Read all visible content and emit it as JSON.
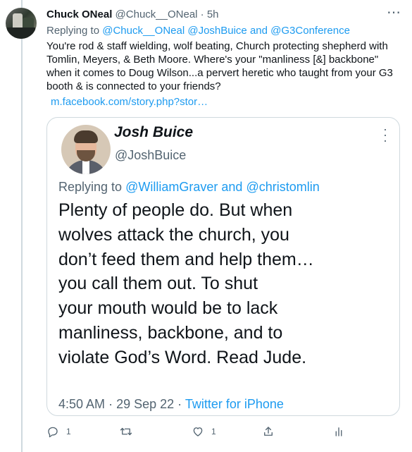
{
  "tweet": {
    "author_name": "Chuck ONeal",
    "author_handle": "@Chuck__ONeal",
    "separator": "·",
    "time": "5h",
    "replying_label": "Replying to",
    "replying_handles": [
      "@Chuck__ONeal",
      "@JoshBuice",
      "@G3Conference"
    ],
    "and_word": "and",
    "body_lines": [
      "You're rod & staff wielding, wolf beating, Church protecting shepherd with",
      "Tomlin, Meyers, & Beth Moore. Where's your \"manliness [&] backbone\"",
      "when it comes to Doug Wilson...a pervert heretic who taught from your G3",
      "booth & is connected to your friends?"
    ],
    "link_text": "m.facebook.com/story.php?stor…",
    "more_icon": "more-horizontal-icon"
  },
  "quote": {
    "author_name": "Josh Buice",
    "author_handle": "@JoshBuice",
    "replying_label": "Replying to",
    "replying_handles": [
      "@WilliamGraver",
      "@christomlin"
    ],
    "and_word": "and",
    "text_lines": [
      "Plenty of people do. But when",
      "wolves attack the church, you",
      "don’t feed them and help them…",
      "you call them out. To shut",
      "your mouth would be to lack",
      "manliness, backbone, and to",
      "violate God’s Word. Read Jude."
    ],
    "time": "4:50 AM",
    "separator": "·",
    "date": "29 Sep 22",
    "source": "Twitter for iPhone"
  },
  "actions": {
    "reply_count": "1",
    "retweet_count": "",
    "like_count": "1",
    "icons": [
      "reply-icon",
      "retweet-icon",
      "like-icon",
      "share-icon",
      "analytics-icon"
    ]
  },
  "colors": {
    "link": "#1d9bf0",
    "muted": "#536471",
    "text": "#0f1419",
    "border": "#cfd9de"
  }
}
